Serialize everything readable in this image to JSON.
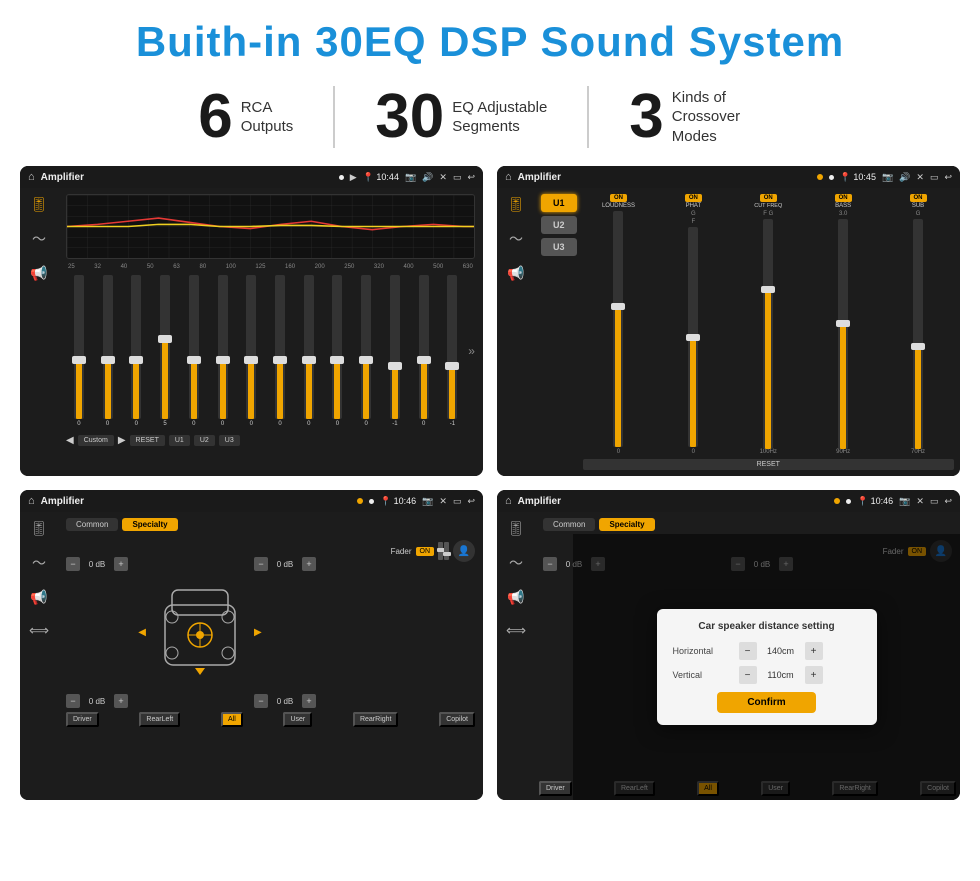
{
  "page": {
    "title": "Buith-in 30EQ DSP Sound System"
  },
  "stats": [
    {
      "number": "6",
      "label": "RCA\nOutputs"
    },
    {
      "number": "30",
      "label": "EQ Adjustable\nSegments"
    },
    {
      "number": "3",
      "label": "Kinds of\nCrossover Modes"
    }
  ],
  "screens": [
    {
      "id": "eq-screen",
      "title": "Amplifier",
      "time": "10:44",
      "type": "eq"
    },
    {
      "id": "crossover-screen",
      "title": "Amplifier",
      "time": "10:45",
      "type": "crossover"
    },
    {
      "id": "speaker-screen",
      "title": "Amplifier",
      "time": "10:46",
      "type": "speaker"
    },
    {
      "id": "dialog-screen",
      "title": "Amplifier",
      "time": "10:46",
      "type": "dialog"
    }
  ],
  "eq": {
    "freqs": [
      "25",
      "32",
      "40",
      "50",
      "63",
      "80",
      "100",
      "125",
      "160",
      "200",
      "250",
      "320",
      "400",
      "500",
      "630"
    ],
    "values": [
      "0",
      "0",
      "0",
      "5",
      "0",
      "0",
      "0",
      "0",
      "0",
      "0",
      "0",
      "-1",
      "0",
      "-1"
    ],
    "buttons": [
      "Custom",
      "RESET",
      "U1",
      "U2",
      "U3"
    ]
  },
  "crossover": {
    "u_buttons": [
      "U1",
      "U2",
      "U3"
    ],
    "channels": [
      {
        "name": "LOUDNESS",
        "on": true
      },
      {
        "name": "PHAT",
        "on": true
      },
      {
        "name": "CUT FREQ",
        "on": true
      },
      {
        "name": "BASS",
        "on": true
      },
      {
        "name": "SUB",
        "on": true
      }
    ],
    "reset_label": "RESET"
  },
  "speaker": {
    "tabs": [
      "Common",
      "Specialty"
    ],
    "fader_label": "Fader",
    "fader_on": "ON",
    "volumes": [
      "0 dB",
      "0 dB",
      "0 dB",
      "0 dB"
    ],
    "bottom_buttons": [
      "Driver",
      "RearLeft",
      "All",
      "User",
      "RearRight",
      "Copilot"
    ]
  },
  "dialog": {
    "title": "Car speaker distance setting",
    "horizontal_label": "Horizontal",
    "horizontal_value": "140cm",
    "vertical_label": "Vertical",
    "vertical_value": "110cm",
    "confirm_label": "Confirm"
  }
}
